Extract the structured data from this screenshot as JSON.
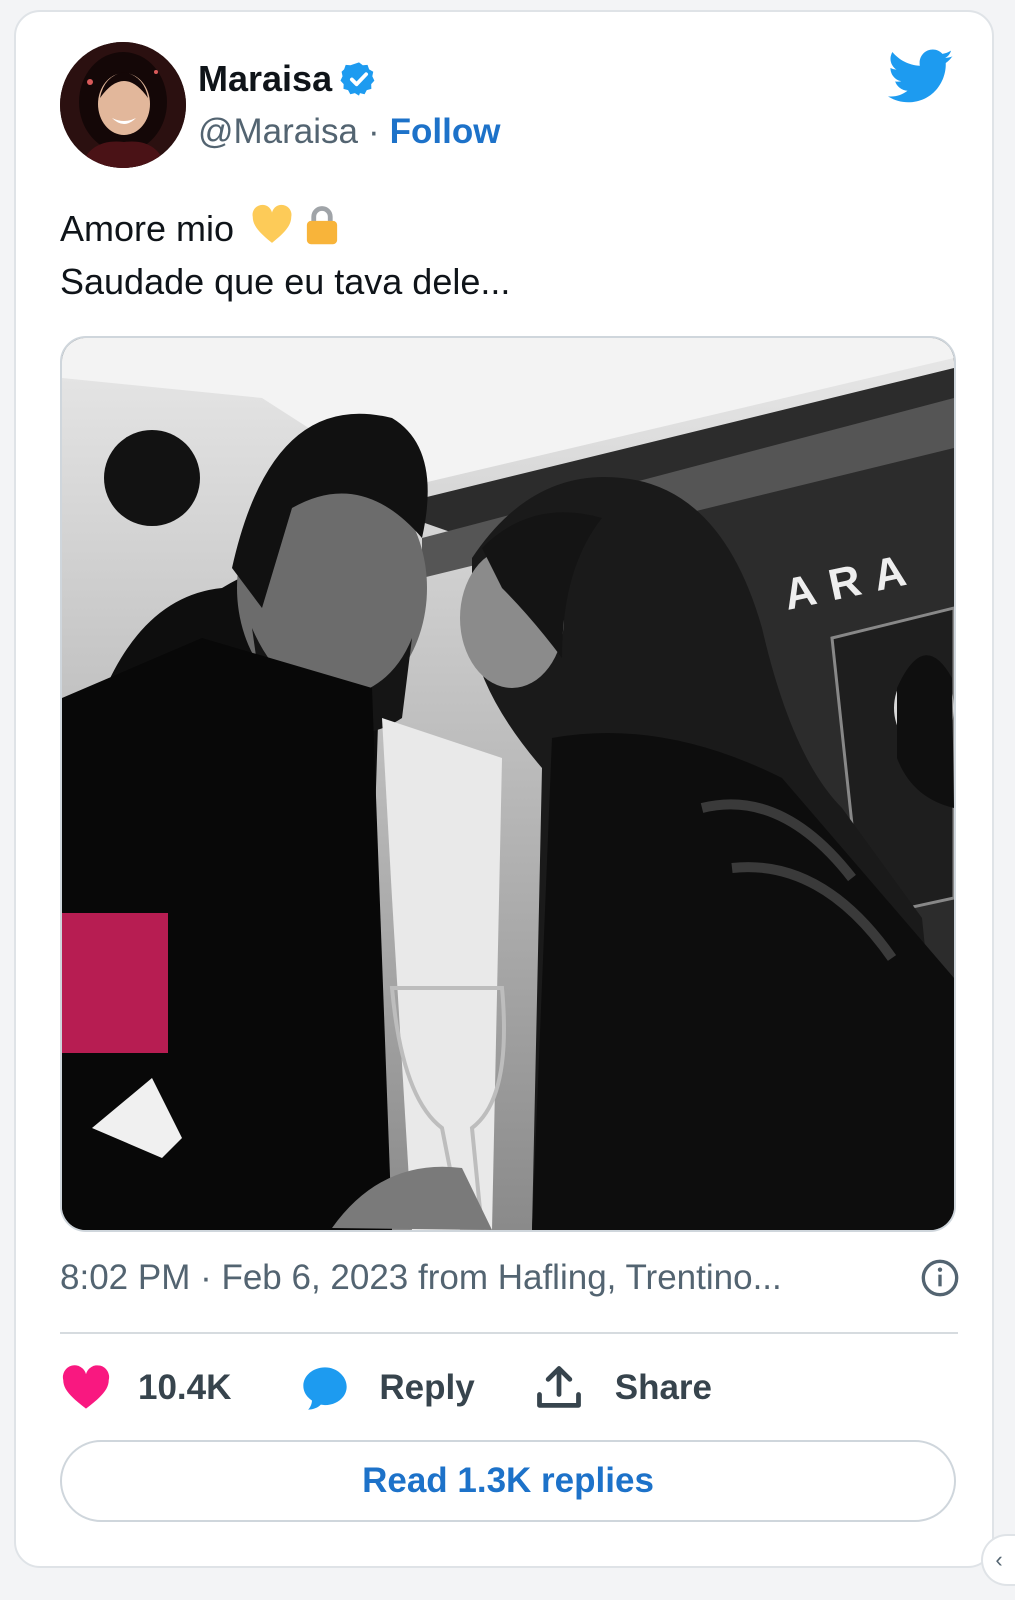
{
  "author": {
    "display_name": "Maraisa",
    "handle": "@Maraisa",
    "separator": "·",
    "follow_label": "Follow"
  },
  "tweet": {
    "line1": "Amore mio",
    "line2": "Saudade que eu tava dele...",
    "emojis": [
      "yellow-heart",
      "lock"
    ],
    "media": {
      "sign_text": "ARA"
    }
  },
  "meta": {
    "timestamp": "8:02 PM · Feb 6, 2023 from Hafling, Trentino..."
  },
  "actions": {
    "likes": "10.4K",
    "reply_label": "Reply",
    "share_label": "Share"
  },
  "replies_button": "Read 1.3K replies",
  "colors": {
    "link_blue": "#1d72c9",
    "twitter_blue": "#1d9bf0",
    "like_pink": "#f91880",
    "verified_blue": "#1d9bf0"
  }
}
